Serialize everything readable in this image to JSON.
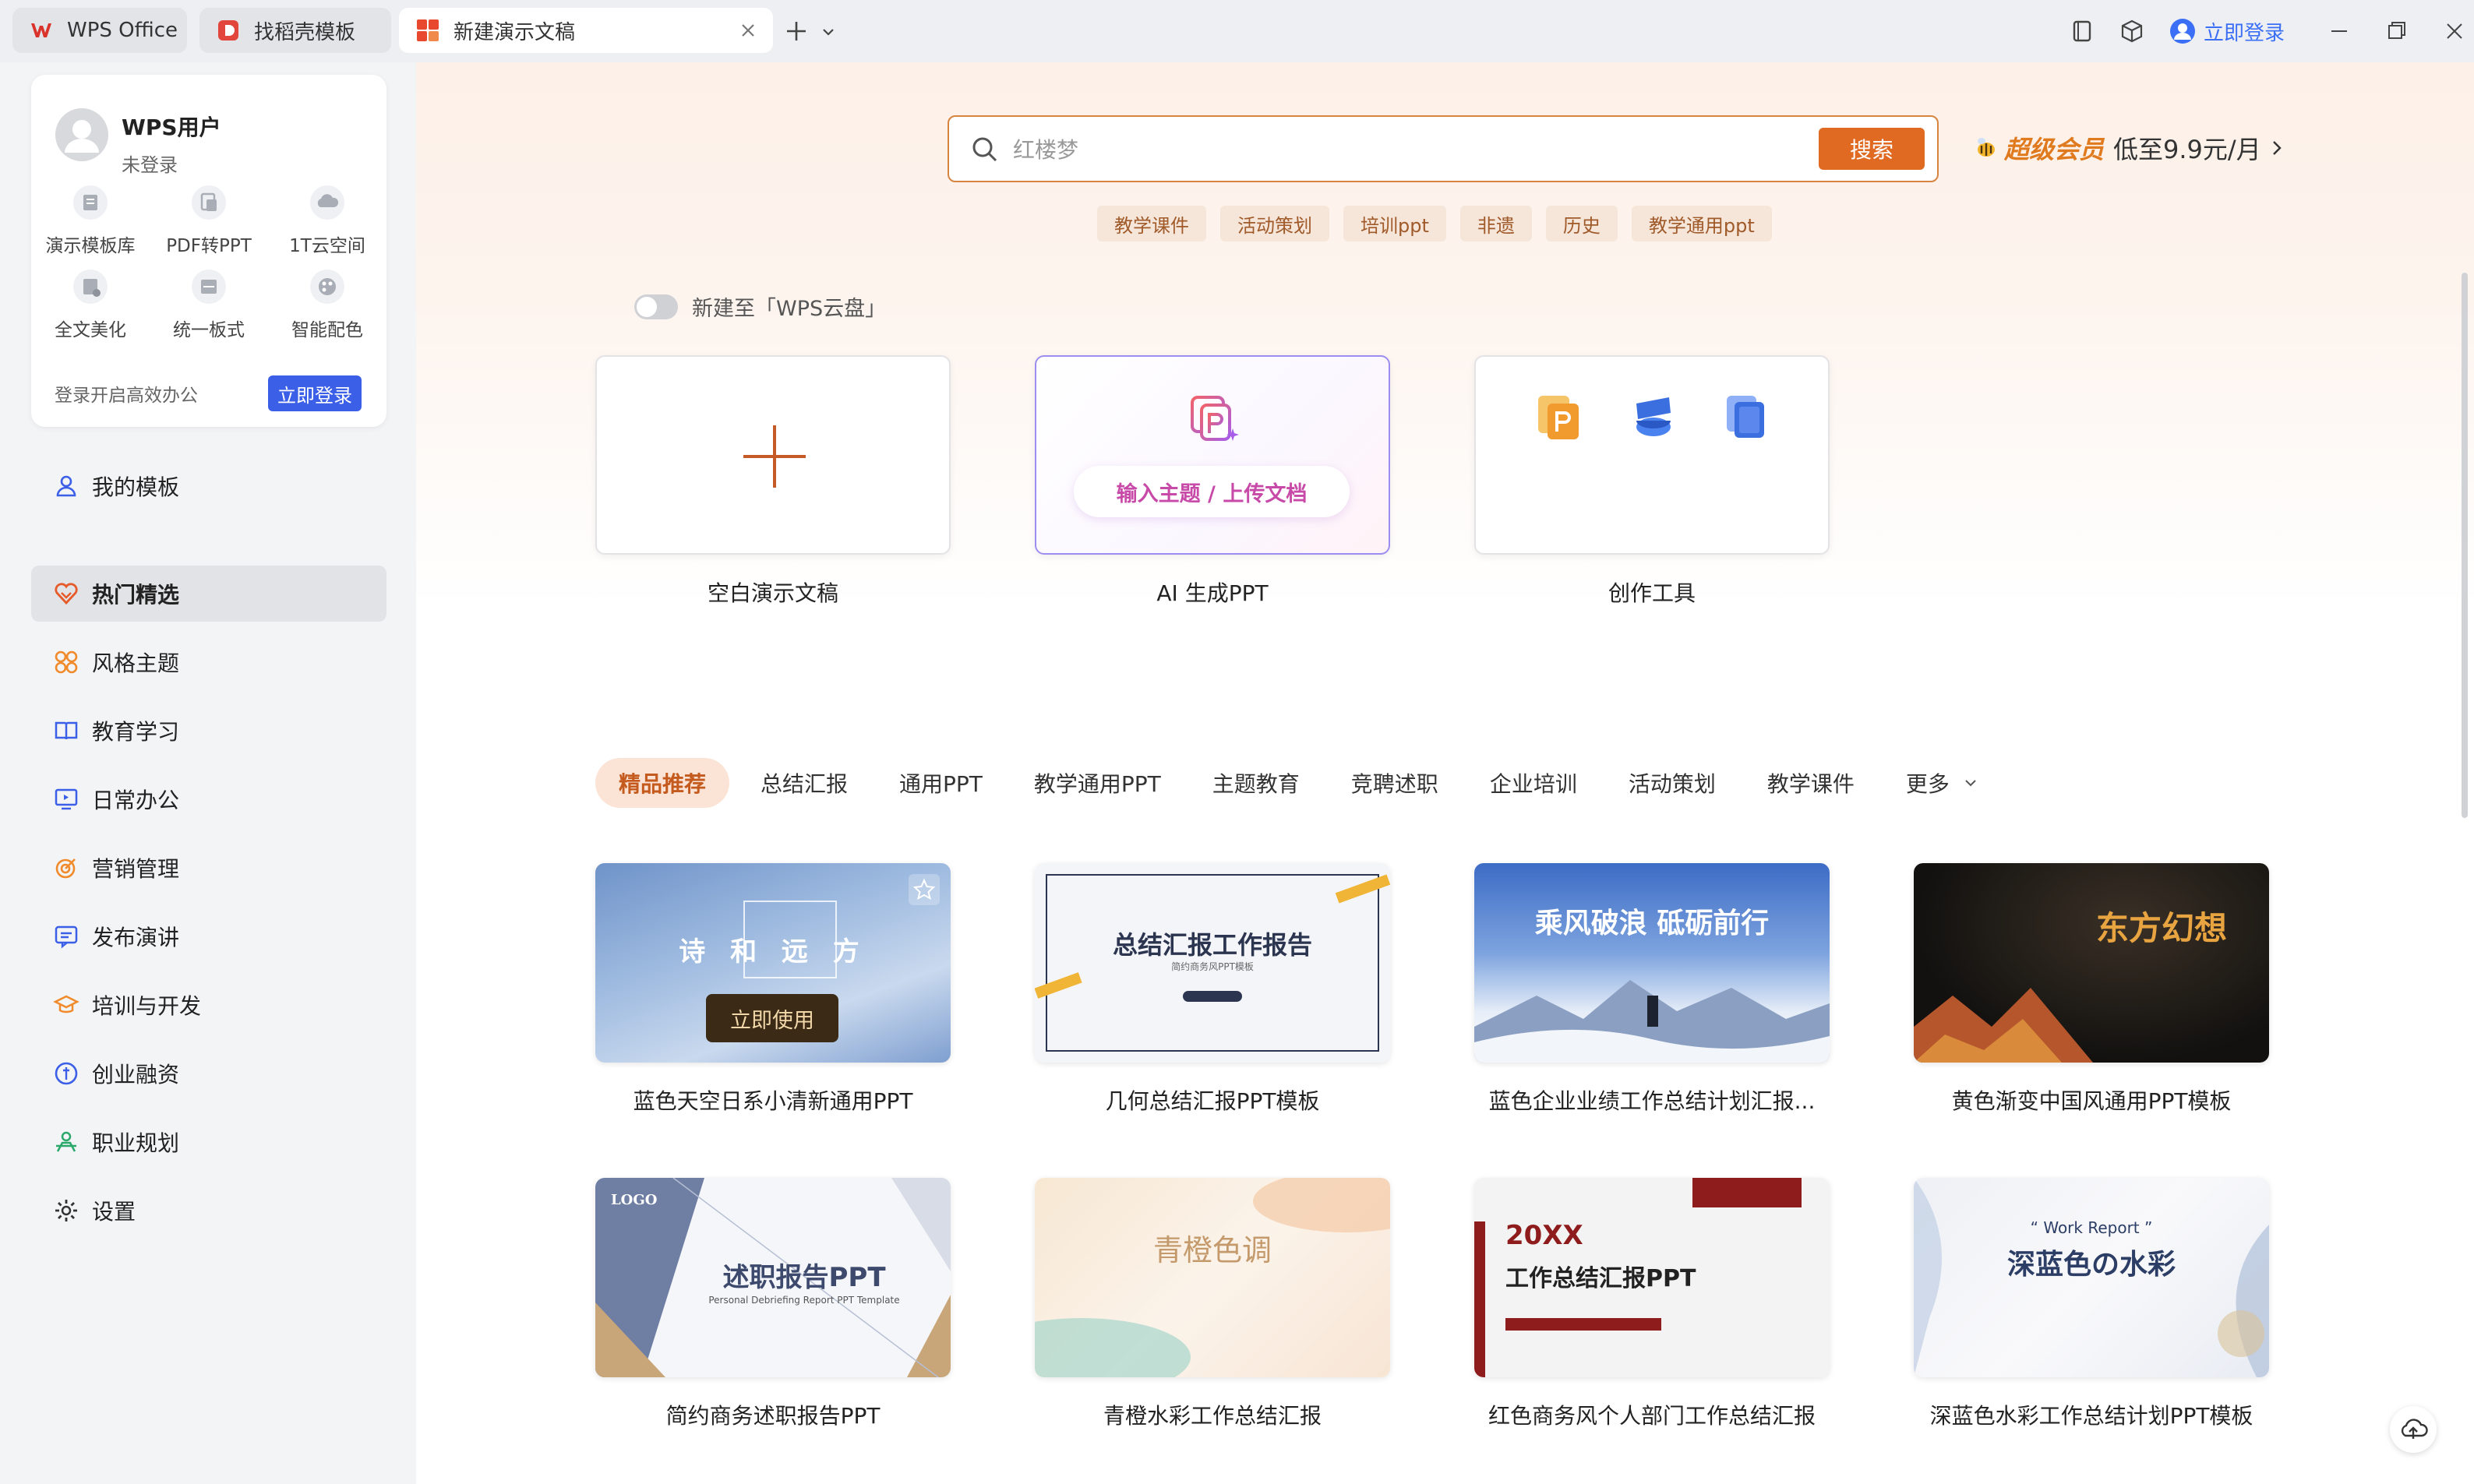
{
  "tabs": [
    {
      "label": "WPS Office"
    },
    {
      "label": "找稻壳模板"
    },
    {
      "label": "新建演示文稿"
    }
  ],
  "topbar": {
    "login_label": "立即登录"
  },
  "colors": {
    "accent": "#e06a22",
    "brand_red": "#d9332b",
    "login_blue": "#3b5fe6",
    "ai_purple": "#c84aa8"
  },
  "user": {
    "name": "WPS用户",
    "status": "未登录"
  },
  "tools": [
    {
      "label": "演示模板库",
      "icon": "template-library-icon"
    },
    {
      "label": "PDF转PPT",
      "icon": "pdf-convert-icon"
    },
    {
      "label": "1T云空间",
      "icon": "cloud-storage-icon"
    },
    {
      "label": "全文美化",
      "icon": "beautify-icon"
    },
    {
      "label": "统一板式",
      "icon": "unify-layout-icon"
    },
    {
      "label": "智能配色",
      "icon": "palette-icon"
    }
  ],
  "card_footer": {
    "text": "登录开启高效办公",
    "button": "立即登录"
  },
  "nav": [
    {
      "label": "我的模板",
      "icon": "user-icon"
    },
    {
      "label": "热门精选",
      "icon": "hot-icon"
    },
    {
      "label": "风格主题",
      "icon": "grid-icon"
    },
    {
      "label": "教育学习",
      "icon": "book-icon"
    },
    {
      "label": "日常办公",
      "icon": "monitor-icon"
    },
    {
      "label": "营销管理",
      "icon": "target-icon"
    },
    {
      "label": "发布演讲",
      "icon": "speech-icon"
    },
    {
      "label": "培训与开发",
      "icon": "graduation-icon"
    },
    {
      "label": "创业融资",
      "icon": "coin-icon"
    },
    {
      "label": "职业规划",
      "icon": "career-icon"
    },
    {
      "label": "设置",
      "icon": "gear-icon"
    }
  ],
  "search": {
    "placeholder": "红楼梦",
    "button": "搜索"
  },
  "vip": {
    "name": "超级会员",
    "price": "低至9.9元/月"
  },
  "hot_tags": [
    "教学课件",
    "活动策划",
    "培训ppt",
    "非遗",
    "历史",
    "教学通用ppt"
  ],
  "cloud_toggle": {
    "label": "新建至「WPS云盘」"
  },
  "create_cards": {
    "blank": "空白演示文稿",
    "ai": "AI 生成PPT",
    "ai_pill": "输入主题 / 上传文档",
    "tools": "创作工具"
  },
  "categories": [
    "精品推荐",
    "总结汇报",
    "通用PPT",
    "教学通用PPT",
    "主题教育",
    "竞聘述职",
    "企业培训",
    "活动策划",
    "教学课件",
    "更多"
  ],
  "templates": [
    {
      "name": "蓝色天空日系小清新通用PPT",
      "thumb_text": "诗 和 远 方",
      "use_label": "立即使用"
    },
    {
      "name": "几何总结汇报PPT模板",
      "thumb_text": "总结汇报工作报告",
      "thumb_sub": "简约商务风PPT模板"
    },
    {
      "name": "蓝色企业业绩工作总结计划汇报...",
      "thumb_text": "乘风破浪 砥砺前行"
    },
    {
      "name": "黄色渐变中国风通用PPT模板",
      "thumb_text": "东方幻想"
    },
    {
      "name": "简约商务述职报告PPT",
      "thumb_text": "述职报告PPT",
      "thumb_sub": "Personal Debriefing Report PPT Template",
      "thumb_logo": "LOGO"
    },
    {
      "name": "青橙水彩工作总结汇报",
      "thumb_text": "青橙色调"
    },
    {
      "name": "红色商务风个人部门工作总结汇报",
      "thumb_text": "20XX",
      "thumb_text2": "工作总结汇报PPT"
    },
    {
      "name": "深蓝色水彩工作总结计划PPT模板",
      "thumb_text": "深蓝色の水彩",
      "thumb_sub": "“ Work Report ”"
    }
  ]
}
